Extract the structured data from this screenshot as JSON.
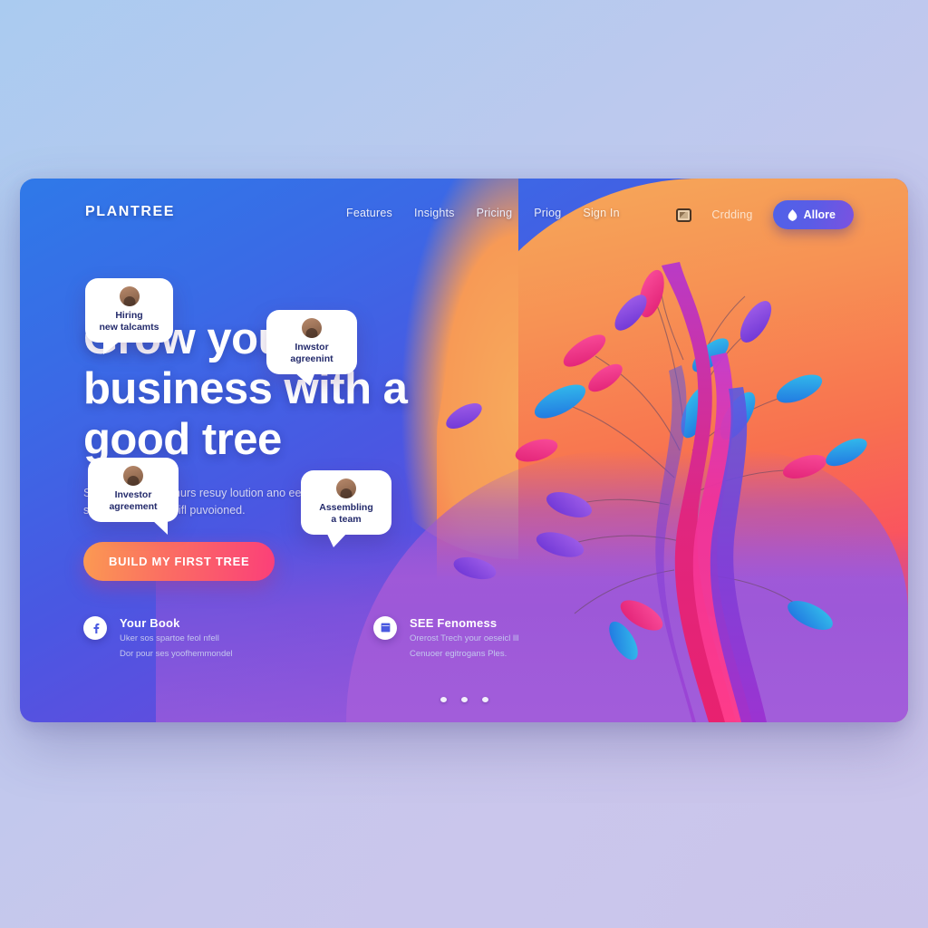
{
  "brand": {
    "logo": "PLANTREE"
  },
  "nav": {
    "items": [
      {
        "label": "Features"
      },
      {
        "label": "Insights"
      },
      {
        "label": "Pricing"
      },
      {
        "label": "Priog"
      },
      {
        "label": "Sign In"
      }
    ],
    "monitor_icon": "monitor-icon",
    "secondary_link": "Crdding",
    "cta": {
      "label": "Allore",
      "icon": "leaf-down-icon"
    }
  },
  "hero": {
    "heading_line1": "Grow your",
    "heading_line2": "business with a",
    "heading_line3": "good tree",
    "subtitle_line1": "Sretwn your chonihurs resuy loution ano eenneil your",
    "subtitle_line2": "shar okut ouebow lifl puvoioned.",
    "cta_label": "BUILD MY FIRST TREE"
  },
  "features": [
    {
      "icon": "facebook-icon",
      "title": "Your Book",
      "line1": "Uker sos spartoe feol nfell",
      "line2": "Dor pour ses yoofhemmondel"
    },
    {
      "icon": "calendar-icon",
      "title": "SEE Fenomess",
      "line1": "Orerost Trech your oeseicl lll",
      "line2": "Cenuoer egitrogans Ples."
    }
  ],
  "bubbles": [
    {
      "text": "Hiring\nnew talcamts",
      "avatar": "person-avatar"
    },
    {
      "text": "Inwstor\nagreenint",
      "avatar": "person-avatar"
    },
    {
      "text": "Investor\nagreement",
      "avatar": "person-avatar"
    },
    {
      "text": "Assembling\na team",
      "avatar": "person-avatar"
    }
  ],
  "carousel": {
    "dots": 3,
    "active": 0
  },
  "colors": {
    "page_bg_start": "#aacbf0",
    "page_bg_end": "#c9c4ea",
    "panel_blue": "#2f79e8",
    "panel_purple": "#8c52d6",
    "blob_orange": "#f5ab5a",
    "blob_red": "#fb3f6e",
    "cta_gradient_start": "#fb9a52",
    "cta_gradient_end": "#fb3f79",
    "nav_button": "#5b5ce6",
    "bubble_text": "#232a6b"
  }
}
